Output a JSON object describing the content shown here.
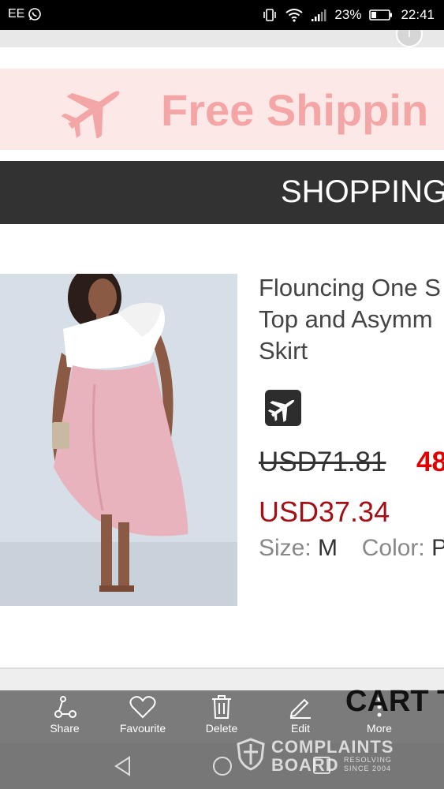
{
  "status_bar": {
    "carrier": "EE",
    "battery": "23%",
    "time": "22:41"
  },
  "banner": {
    "free_shipping": "Free Shippin",
    "shopping": "SHOPPING"
  },
  "product": {
    "title": "Flouncing One S\nTop and Asymm\nSkirt",
    "old_price": "USD71.81",
    "discount": "48",
    "new_price": "USD37.34",
    "size_label": "Size:",
    "size_value": "M",
    "color_label": "Color:",
    "color_value": "P"
  },
  "actions": [
    {
      "label": "Share",
      "icon": "share-icon"
    },
    {
      "label": "Favourite",
      "icon": "heart-icon"
    },
    {
      "label": "Delete",
      "icon": "trash-icon"
    },
    {
      "label": "Edit",
      "icon": "pencil-icon"
    },
    {
      "label": "More",
      "icon": "more-icon"
    }
  ],
  "cart_header": "CART T",
  "watermark": {
    "line1": "COMPLAINTS",
    "line2": "BOARD",
    "line3": "RESOLVING",
    "line4": "SINCE 2004"
  },
  "colors": {
    "status_bar": "#000000",
    "shipping_banner": "#fde8e8",
    "shipping_text": "#f4a6a6",
    "shopping_bar": "#323232",
    "discount": "#e00000",
    "new_price": "#a30f14",
    "action_bar": "#7b7b7b"
  }
}
